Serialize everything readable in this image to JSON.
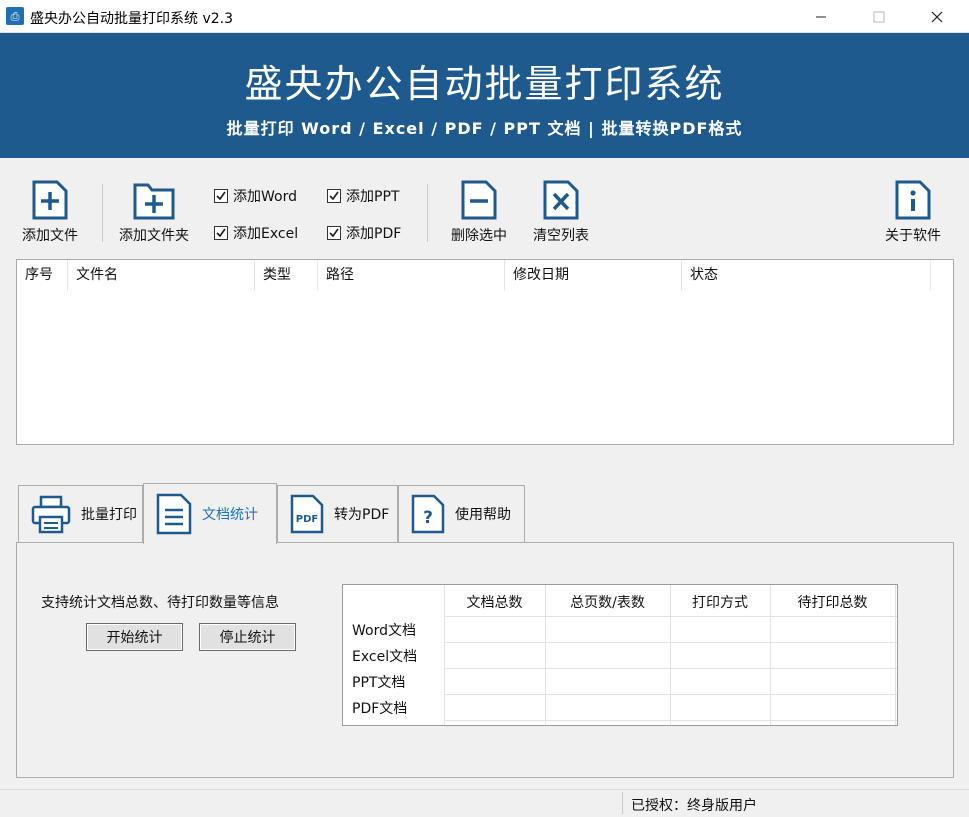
{
  "window": {
    "title": "盛央办公自动批量打印系统 v2.3",
    "minimize_glyph": "—",
    "maximize_glyph": "☐",
    "close_glyph": "✕"
  },
  "banner": {
    "title": "盛央办公自动批量打印系统",
    "subtitle": "批量打印 Word / Excel / PDF / PPT 文档  |  批量转换PDF格式",
    "background_color": "#1e5a8e"
  },
  "toolbar": {
    "add_file": "添加文件",
    "add_folder": "添加文件夹",
    "check_word": "添加Word",
    "check_excel": "添加Excel",
    "check_ppt": "添加PPT",
    "check_pdf": "添加PDF",
    "delete_selected": "删除选中",
    "clear_list": "清空列表",
    "about": "关于软件",
    "icon_color": "#1e5a8e",
    "checks": {
      "word": true,
      "excel": true,
      "ppt": true,
      "pdf": true
    }
  },
  "file_list": {
    "columns": [
      "序号",
      "文件名",
      "类型",
      "路径",
      "修改日期",
      "状态"
    ],
    "rows": []
  },
  "tabs": [
    {
      "label": "批量打印",
      "icon": "printer-icon",
      "active": false
    },
    {
      "label": "文档统计",
      "icon": "document-lines-icon",
      "active": true
    },
    {
      "label": "转为PDF",
      "icon": "pdf-icon",
      "active": false
    },
    {
      "label": "使用帮助",
      "icon": "help-icon",
      "active": false
    }
  ],
  "stats_panel": {
    "description": "支持统计文档总数、待打印数量等信息",
    "start_button": "开始统计",
    "stop_button": "停止统计",
    "table": {
      "headers": [
        "文档总数",
        "总页数/表数",
        "打印方式",
        "待打印总数"
      ],
      "rows": [
        "Word文档",
        "Excel文档",
        "PPT文档",
        "PDF文档"
      ]
    }
  },
  "status_bar": {
    "license": "已授权：终身版用户"
  }
}
